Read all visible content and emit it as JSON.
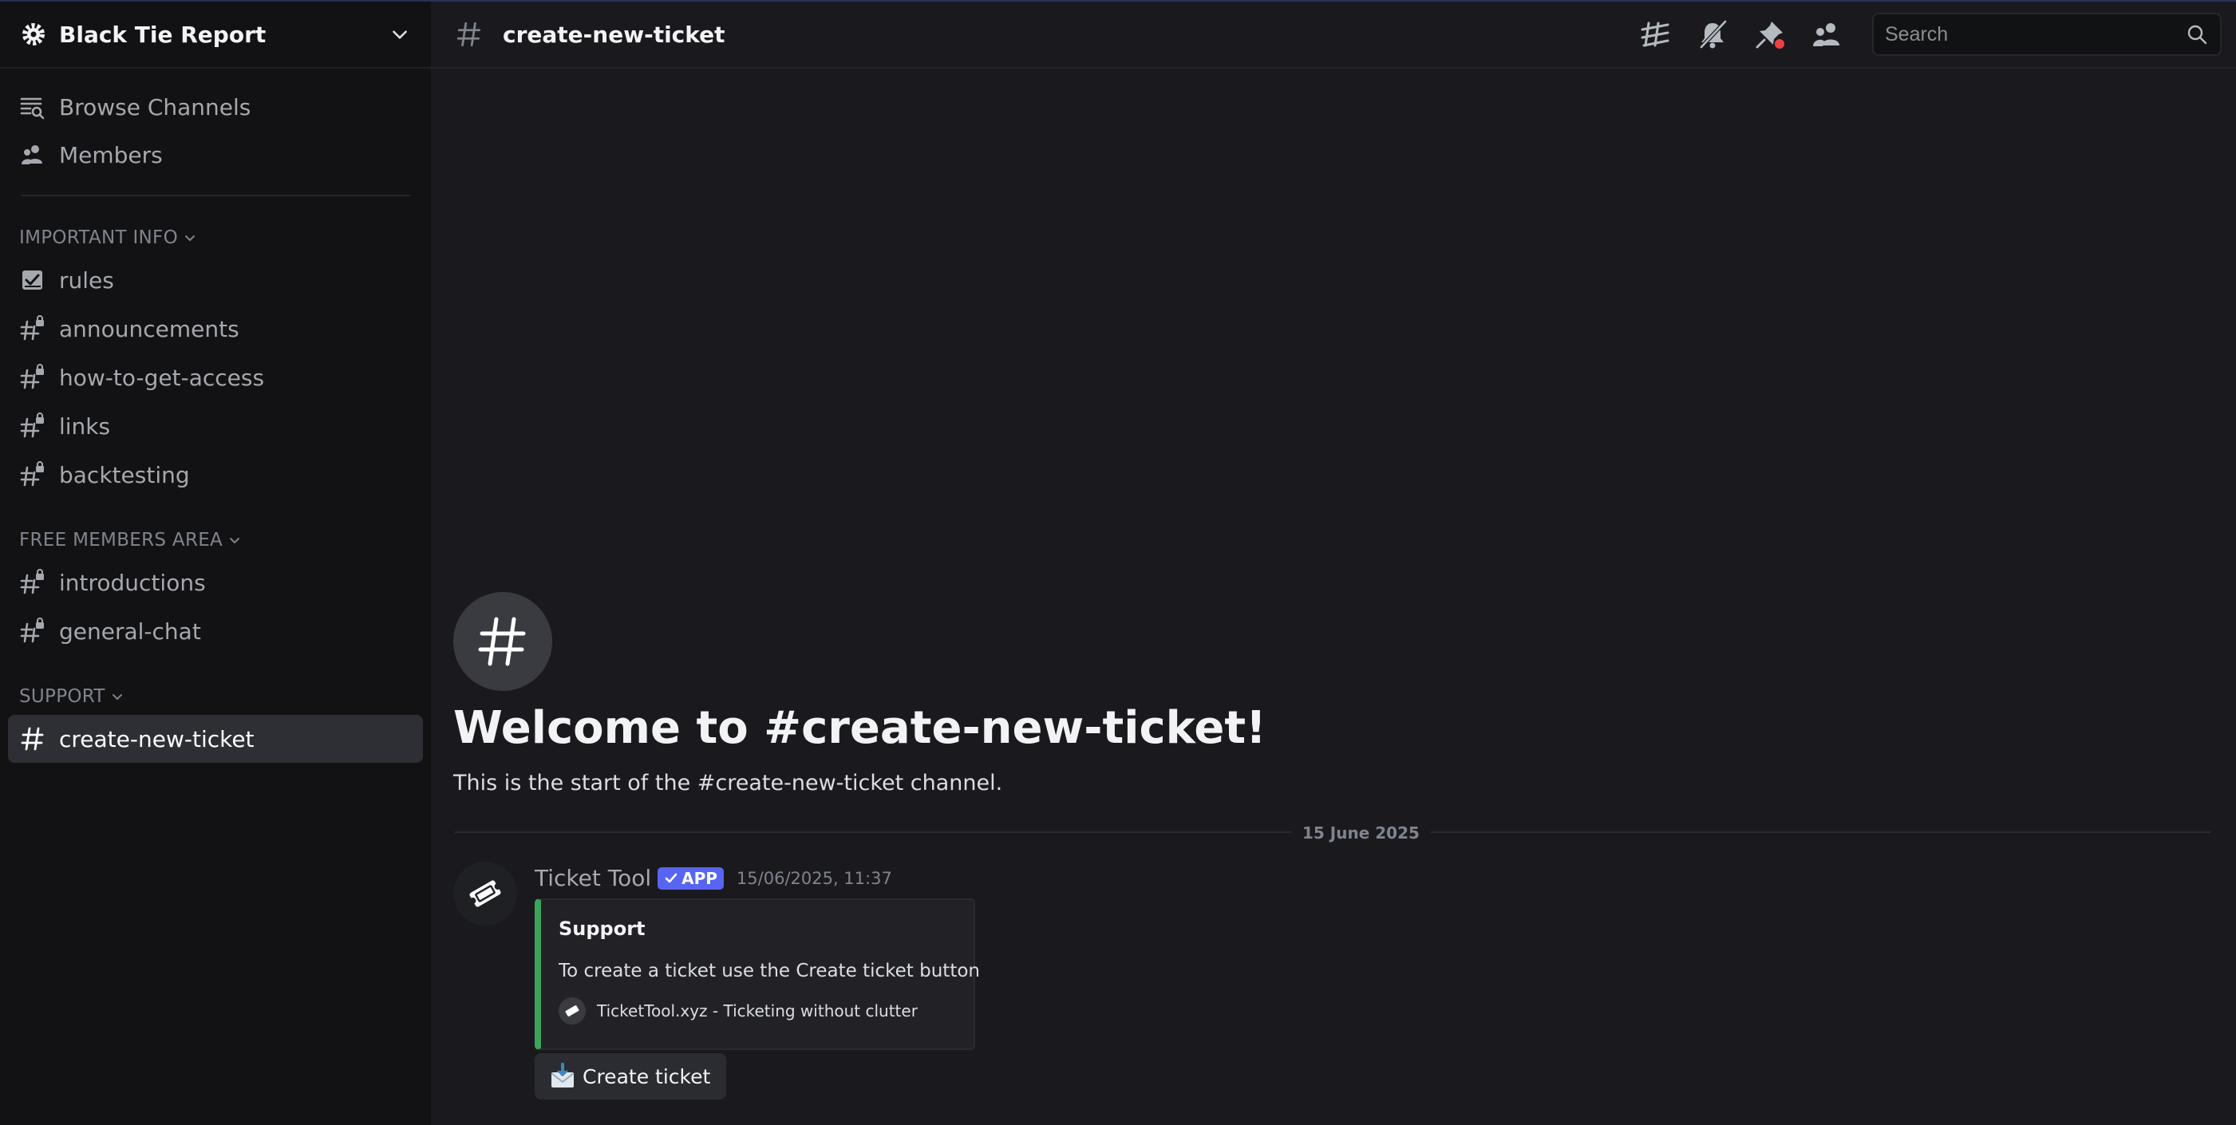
{
  "server": {
    "name": "Black Tie Report"
  },
  "nav": [
    {
      "label": "Browse Channels",
      "icon": "browse-channels-icon"
    },
    {
      "label": "Members",
      "icon": "members-icon"
    }
  ],
  "categories": [
    {
      "name": "IMPORTANT INFO",
      "channels": [
        "rules",
        "announcements",
        "how-to-get-access",
        "links",
        "backtesting"
      ]
    },
    {
      "name": "FREE MEMBERS AREA",
      "channels": [
        "introductions",
        "general-chat"
      ]
    },
    {
      "name": "SUPPORT",
      "channels": [
        "create-new-ticket"
      ]
    }
  ],
  "header": {
    "channel": "create-new-ticket",
    "search_placeholder": "Search",
    "icons": [
      "threads-icon",
      "mute-bell-icon",
      "pin-icon",
      "member-list-icon",
      "search-icon"
    ]
  },
  "welcome": {
    "title": "Welcome to #create-new-ticket!",
    "subtitle": "This is the start of the #create-new-ticket channel."
  },
  "date_divider": "15 June 2025",
  "message": {
    "author": "Ticket Tool",
    "badge": "APP",
    "timestamp": "15/06/2025, 11:37",
    "embed": {
      "title": "Support",
      "description": "To create a ticket use the Create ticket button",
      "footer": "TicketTool.xyz - Ticketing without clutter",
      "accent": "#3ba55c"
    },
    "button": {
      "emoji": "envelope-with-arrow-icon",
      "label": "Create ticket"
    }
  },
  "colors": {
    "accent": "#5865f2",
    "active_channel_bg": "#2e2f34",
    "notification": "#f23f43"
  }
}
